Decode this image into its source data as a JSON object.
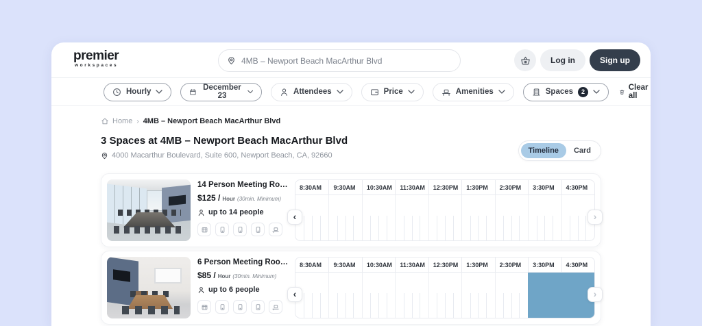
{
  "header": {
    "logo_main": "premier",
    "logo_sub": "workspaces",
    "search": {
      "value": "4MB – Newport Beach MacArthur Blvd"
    },
    "login_label": "Log in",
    "signup_label": "Sign up"
  },
  "filters": {
    "items": [
      {
        "label": "Hourly",
        "icon": "clock-icon"
      },
      {
        "label": "December 23",
        "icon": "calendar-icon"
      },
      {
        "label": "Attendees",
        "icon": "person-icon"
      },
      {
        "label": "Price",
        "icon": "wallet-icon"
      },
      {
        "label": "Amenities",
        "icon": "desk-icon"
      },
      {
        "label": "Spaces",
        "icon": "building-icon",
        "badge": "2"
      }
    ],
    "clear_label": "Clear all"
  },
  "breadcrumb": {
    "home": "Home",
    "separator": "›",
    "current": "4MB – Newport Beach MacArthur Blvd"
  },
  "results": {
    "title": "3 Spaces at 4MB – Newport Beach MacArthur Blvd",
    "address": "4000 Macarthur Boulevard, Suite 600, Newport Beach, CA, 92660",
    "view_toggle": {
      "timeline": "Timeline",
      "card": "Card",
      "selected": "Timeline"
    }
  },
  "timeline": {
    "times": [
      "8:30AM",
      "9:30AM",
      "10:30AM",
      "11:30AM",
      "12:30PM",
      "1:30PM",
      "2:30PM",
      "3:30PM",
      "4:30PM"
    ],
    "nav_prev": "‹",
    "nav_next": "›"
  },
  "listings": [
    {
      "name": "14 Person Meeting Ro…",
      "price": "$125 /",
      "price_unit": "Hour",
      "price_note": "(30min. Minimum)",
      "capacity": "up to 14 people",
      "selection": null
    },
    {
      "name": "6 Person Meeting Roo…",
      "price": "$85 /",
      "price_unit": "Hour",
      "price_note": "(30min. Minimum)",
      "capacity": "up to 6 people",
      "selection": {
        "columns": [
          "3:30PM",
          "4:30PM"
        ]
      }
    }
  ],
  "colors": {
    "page_bg": "#dbe2fb",
    "selection_blue": "#6fa5c7",
    "toggle_active_bg": "#a9cbe6",
    "signup_bg": "#343e4c",
    "badge_bg": "#1f2733"
  }
}
